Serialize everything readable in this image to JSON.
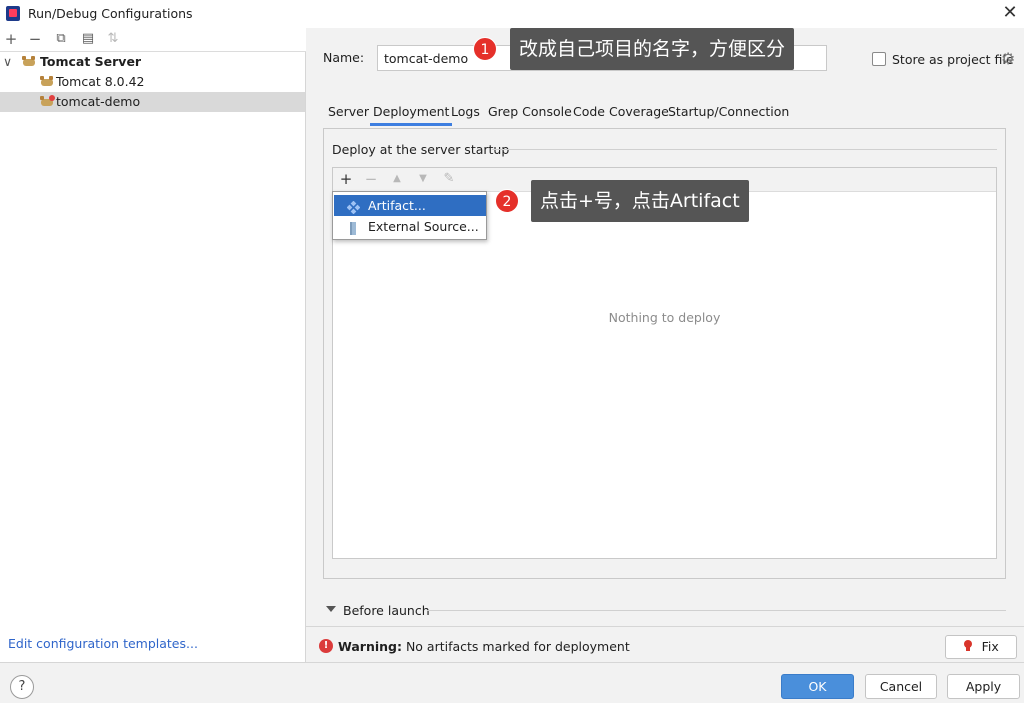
{
  "window": {
    "title": "Run/Debug Configurations",
    "close": "✕"
  },
  "left_toolbar": {
    "add": "+",
    "remove": "−",
    "copy": "⧉",
    "folder": "▤",
    "sort": "⇅"
  },
  "tree": [
    {
      "label": "Tomcat Server",
      "expand": "∨"
    },
    {
      "label": "Tomcat 8.0.42"
    },
    {
      "label": "tomcat-demo"
    }
  ],
  "edit_templates": "Edit configuration templates...",
  "name": {
    "label": "Name:",
    "value": "tomcat-demo"
  },
  "store_as_project_file": "Store as project file",
  "gear": "⚙",
  "tabs": [
    "Server",
    "Deployment",
    "Logs",
    "Grep Console",
    "Code Coverage",
    "Startup/Connection"
  ],
  "active_tab": "Deployment",
  "deploy": {
    "header": "Deploy at the server startup",
    "toolbar": {
      "add": "+",
      "remove": "−",
      "up": "▲",
      "down": "▼",
      "edit": "✎"
    },
    "empty_text": "Nothing to deploy"
  },
  "popup": {
    "items": [
      "Artifact...",
      "External Source..."
    ]
  },
  "callouts": [
    {
      "num": "1",
      "text": "改成自己项目的名字，方便区分"
    },
    {
      "num": "2",
      "text": "点击+号，点击Artifact"
    }
  ],
  "before_launch": "Before launch",
  "warning": {
    "icon": "!",
    "strong": "Warning:",
    "text": " No artifacts marked for deployment"
  },
  "fix": {
    "icon": "💡",
    "label": "Fix"
  },
  "help": "?",
  "buttons": {
    "ok": "OK",
    "cancel": "Cancel",
    "apply": "Apply"
  },
  "colors": {
    "accent": "#3d7ee0",
    "callout_bg": "#555555",
    "badge": "#e5302a",
    "selection": "#2f6ec2",
    "link": "#2f65ca",
    "error": "#db3b3b"
  }
}
